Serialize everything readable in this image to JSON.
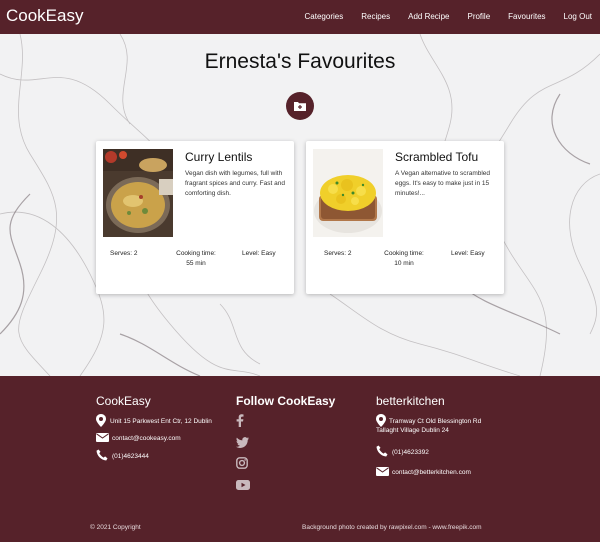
{
  "nav": {
    "brand": "CookEasy",
    "links": [
      "Categories",
      "Recipes",
      "Add Recipe",
      "Profile",
      "Favourites",
      "Log Out"
    ]
  },
  "page": {
    "title": "Ernesta's Favourites"
  },
  "cards": [
    {
      "title": "Curry Lentils",
      "description": "Vegan dish with legumes, full with fragrant spices and curry. Fast and comforting dish.",
      "serves": "Serves: 2",
      "cooking_time_label": "Cooking time:",
      "cooking_time": "55 min",
      "level": "Level: Easy"
    },
    {
      "title": "Scrambled Tofu",
      "description": "A Vegan alternative to scrambled eggs. It's easy to make just in 15 minutes!...",
      "serves": "Serves: 2",
      "cooking_time_label": "Cooking time:",
      "cooking_time": "10 min",
      "level": "Level: Easy"
    }
  ],
  "footer": {
    "col1": {
      "title": "CookEasy",
      "address": "Unit 15 Parkwest Ent Ctr, 12 Dublin",
      "email": "contact@cookeasy.com",
      "phone": "(01)4623444"
    },
    "col2": {
      "title": "Follow CookEasy",
      "icons": [
        "facebook-icon",
        "twitter-icon",
        "instagram-icon",
        "youtube-icon"
      ]
    },
    "col3": {
      "title": "betterkitchen",
      "address_line1": "Tramway Ct Old Blessington Rd",
      "address_line2": "Tallaght Village Dublin 24",
      "phone": "(01)4623392",
      "email": "contact@betterkitchen.com"
    },
    "copyright": "© 2021 Copyright",
    "credit": "Background photo created by rawpixel.com - www.freepik.com"
  },
  "colors": {
    "brand": "#56222a",
    "background": "#f3f3f4"
  }
}
